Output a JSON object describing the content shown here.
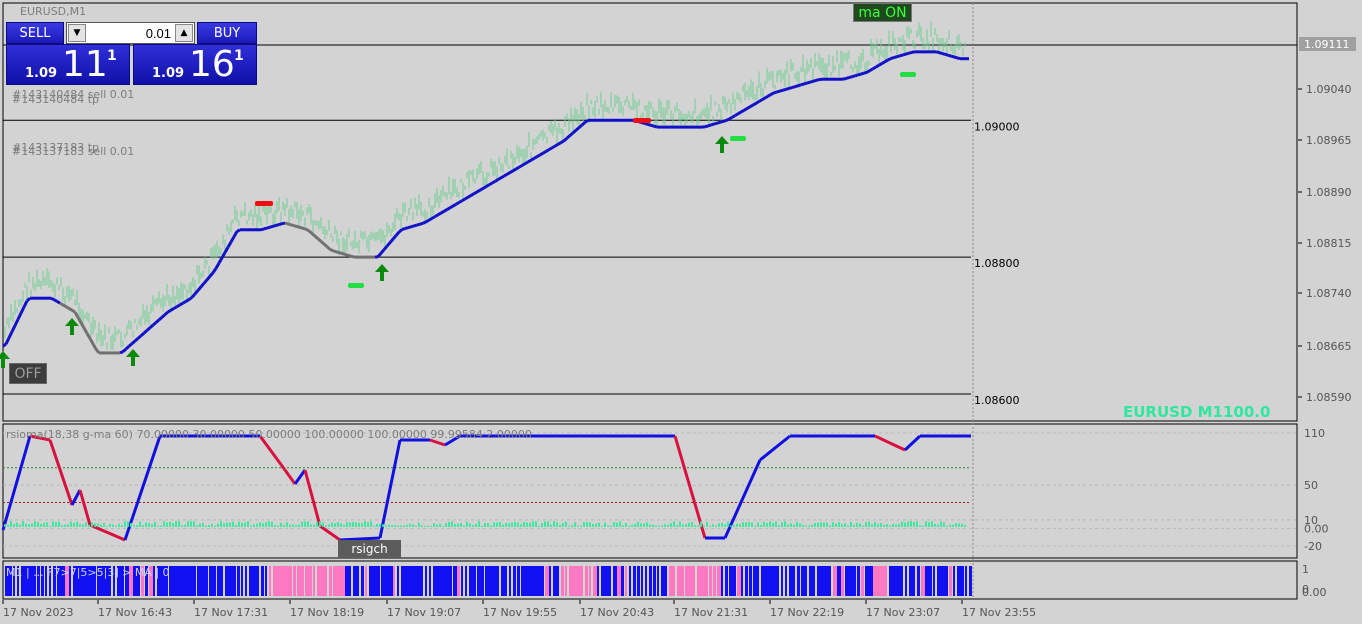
{
  "window": {
    "title": "EURUSD,M1"
  },
  "trade_panel": {
    "sell_label": "SELL",
    "buy_label": "BUY",
    "lot_value": "0.01",
    "sell_quote": {
      "prefix": "1.09",
      "big": "11",
      "sup": "1"
    },
    "buy_quote": {
      "prefix": "1.09",
      "big": "16",
      "sup": "1"
    }
  },
  "buttons": {
    "ma": "ma ON",
    "off": "OFF",
    "rsigch": "rsigch"
  },
  "order_labels": [
    "#143140484 sell 0.01",
    "#143140484 tp",
    "#143137183 tp",
    "#143137183 sell 0.01"
  ],
  "price_axis": {
    "labels": [
      "1.09040",
      "1.08965",
      "1.08890",
      "1.08815",
      "1.08740",
      "1.08665",
      "1.08590"
    ],
    "current_price": "1.09111"
  },
  "levels": [
    "1.09000",
    "1.08800",
    "1.08600"
  ],
  "symbol_label": {
    "symbol": "EURUSD M1",
    "value": "100.0"
  },
  "rsioma": {
    "title": "rsioma(18,38 g-ma 60) 70.00000 30.00000 50.00000 100.00000 100.00000 99.99584 2.00000",
    "axis_labels": [
      "110",
      "50",
      "10",
      "0.00",
      "-20"
    ]
  },
  "bottom_panel": {
    "text": "M1 | ... F7>7|5>5|3] > MA | 0",
    "axis_labels": [
      "1",
      "0",
      "0.00"
    ]
  },
  "time_axis": [
    "17 Nov 2023",
    "17 Nov 16:43",
    "17 Nov 17:31",
    "17 Nov 18:19",
    "17 Nov 19:07",
    "17 Nov 19:55",
    "17 Nov 20:43",
    "17 Nov 21:31",
    "17 Nov 22:19",
    "17 Nov 23:07",
    "17 Nov 23:55"
  ],
  "colors": {
    "background": "#d3d3d3",
    "price_bars": "#6fcf92",
    "ma_up": "#1010c8",
    "ma_flat": "#707070",
    "rsi_up": "#1010e0",
    "rsi_down": "#d81040",
    "buy_arrow": "#0a8a0a",
    "sell_mark": "#ee1010",
    "bar_blue": "#1010f0",
    "bar_pink": "#ff78c0"
  },
  "chart_data": {
    "type": "line",
    "series": [
      {
        "values": [
          1.0867,
          1.0874,
          1.0874,
          1.0872,
          1.0866,
          1.0866,
          1.0869,
          1.0872,
          1.0874,
          1.0878,
          1.0884,
          1.0884,
          1.0885,
          1.0884,
          1.0881,
          1.088,
          1.088,
          1.0884,
          1.0885,
          1.0887,
          1.0889,
          1.0891,
          1.0893,
          1.0895,
          1.0897,
          1.09,
          1.09,
          1.09,
          1.0899,
          1.0899,
          1.0899,
          1.09,
          1.0902,
          1.0904,
          1.0905,
          1.0906,
          1.0906,
          1.0907,
          1.0909,
          1.091,
          1.091,
          1.0909
        ]
      }
    ],
    "ylim": [
      1.0858,
      1.0913
    ]
  }
}
